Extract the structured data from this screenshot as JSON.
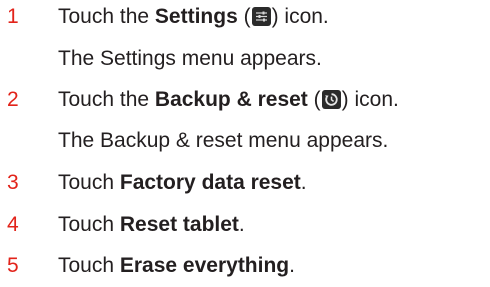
{
  "steps": [
    {
      "number": "1",
      "prefix": "Touch the ",
      "bold": "Settings",
      "mid": " (",
      "icon": "settings-icon",
      "suffix": ") icon."
    },
    {
      "result": "The Settings menu appears."
    },
    {
      "number": "2",
      "prefix": "Touch the ",
      "bold": "Backup & reset",
      "mid": " (",
      "icon": "backup-reset-icon",
      "suffix": ") icon."
    },
    {
      "result": "The Backup & reset menu appears."
    },
    {
      "number": "3",
      "prefix": "Touch ",
      "bold": "Factory data reset",
      "suffix": "."
    },
    {
      "number": "4",
      "prefix": "Touch ",
      "bold": "Reset tablet",
      "suffix": "."
    },
    {
      "number": "5",
      "prefix": "Touch ",
      "bold": "Erase everything",
      "suffix": "."
    }
  ],
  "colors": {
    "step_number": "#e2231a",
    "text": "#231f20",
    "icon_bg": "#2b2b2b"
  }
}
